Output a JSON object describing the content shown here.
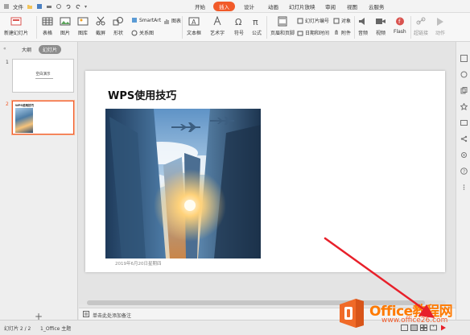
{
  "menubar": {
    "file_label": "文件",
    "tabs": [
      "开始",
      "插入",
      "设计",
      "动画",
      "幻灯片放映",
      "审阅",
      "视图",
      "云服务"
    ],
    "active_tab": "插入"
  },
  "ribbon": {
    "new_slide": "新建幻灯片",
    "table": "表格",
    "picture": "图片",
    "gallery": "图库",
    "screenshot": "截屏",
    "shape": "形状",
    "smartart": "SmartArt",
    "chart": "图表",
    "relation": "关系图",
    "textbox": "文本框",
    "wordart": "艺术字",
    "symbol": "符号",
    "formula": "公式",
    "header_footer": "页眉和页脚",
    "slide_number": "幻灯片编号",
    "object": "对象",
    "date_time": "日期和时间",
    "attachment": "附件",
    "audio": "音频",
    "video": "视频",
    "flash": "Flash",
    "hyperlink": "超链接",
    "action": "动作"
  },
  "left_panel": {
    "tab_outline": "大纲",
    "tab_slides": "幻灯片",
    "thumbs": [
      {
        "number": "1",
        "title": "空白演示"
      },
      {
        "number": "2",
        "title": "WPS使用技巧"
      }
    ]
  },
  "slide": {
    "title": "WPS使用技巧",
    "caption": "2019年6月20日星期四"
  },
  "notes": {
    "placeholder": "单击此处添加备注"
  },
  "status": {
    "slide_info": "幻灯片 2 / 2",
    "theme": "1_Office 主题"
  },
  "watermark": {
    "brand": "Office教程网",
    "url": "www.office26.com"
  },
  "colors": {
    "accent": "#f15a29",
    "arrow": "#e8202a",
    "watermark": "#ff7a00"
  }
}
